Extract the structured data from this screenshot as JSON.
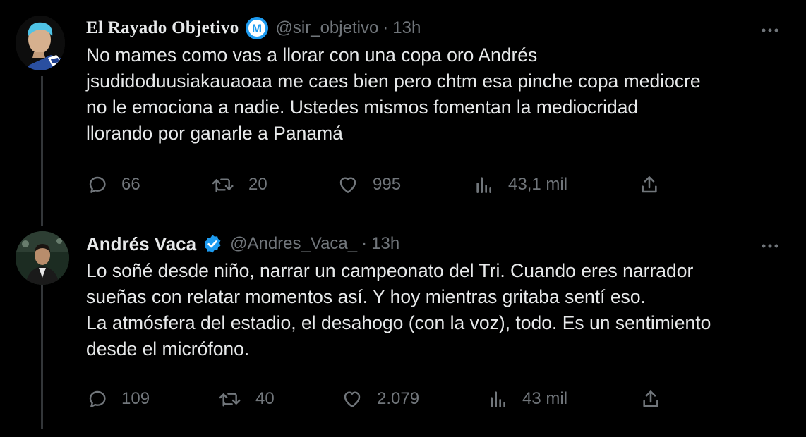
{
  "tweets": [
    {
      "author": {
        "name": "El Rayado Objetivo",
        "badge_letter": "M",
        "handle": "@sir_objetivo",
        "separator": "·",
        "time": "13h"
      },
      "text_lines": [
        "No mames como vas a llorar con una copa oro Andrés",
        "jsudidoduusiakauaoaa me caes bien pero chtm esa pinche copa mediocre",
        "no le emociona a nadie. Ustedes mismos fomentan la mediocridad",
        "llorando por ganarle a Panamá"
      ],
      "actions": {
        "replies": "66",
        "retweets": "20",
        "likes": "995",
        "views": "43,1 mil"
      }
    },
    {
      "author": {
        "name": "Andrés Vaca",
        "handle": "@Andres_Vaca_",
        "separator": "·",
        "time": "13h"
      },
      "text_lines": [
        "Lo soñé desde niño, narrar un campeonato del Tri. Cuando eres narrador",
        "sueñas con relatar momentos así. Y hoy mientras gritaba sentí eso.",
        "La atmósfera del estadio, el desahogo (con la voz), todo. Es un sentimiento",
        "desde el micrófono."
      ],
      "actions": {
        "replies": "109",
        "retweets": "40",
        "likes": "2.079",
        "views": "43 mil"
      }
    }
  ],
  "colors": {
    "background": "#000000",
    "text": "#e7e9ea",
    "muted": "#71767b",
    "verified_blue": "#1d9bf0",
    "thread_line": "#333639"
  },
  "icons": [
    "reply-icon",
    "retweet-icon",
    "like-icon",
    "views-icon",
    "share-icon",
    "more-icon",
    "verified-badge-icon",
    "brand-badge-icon"
  ]
}
